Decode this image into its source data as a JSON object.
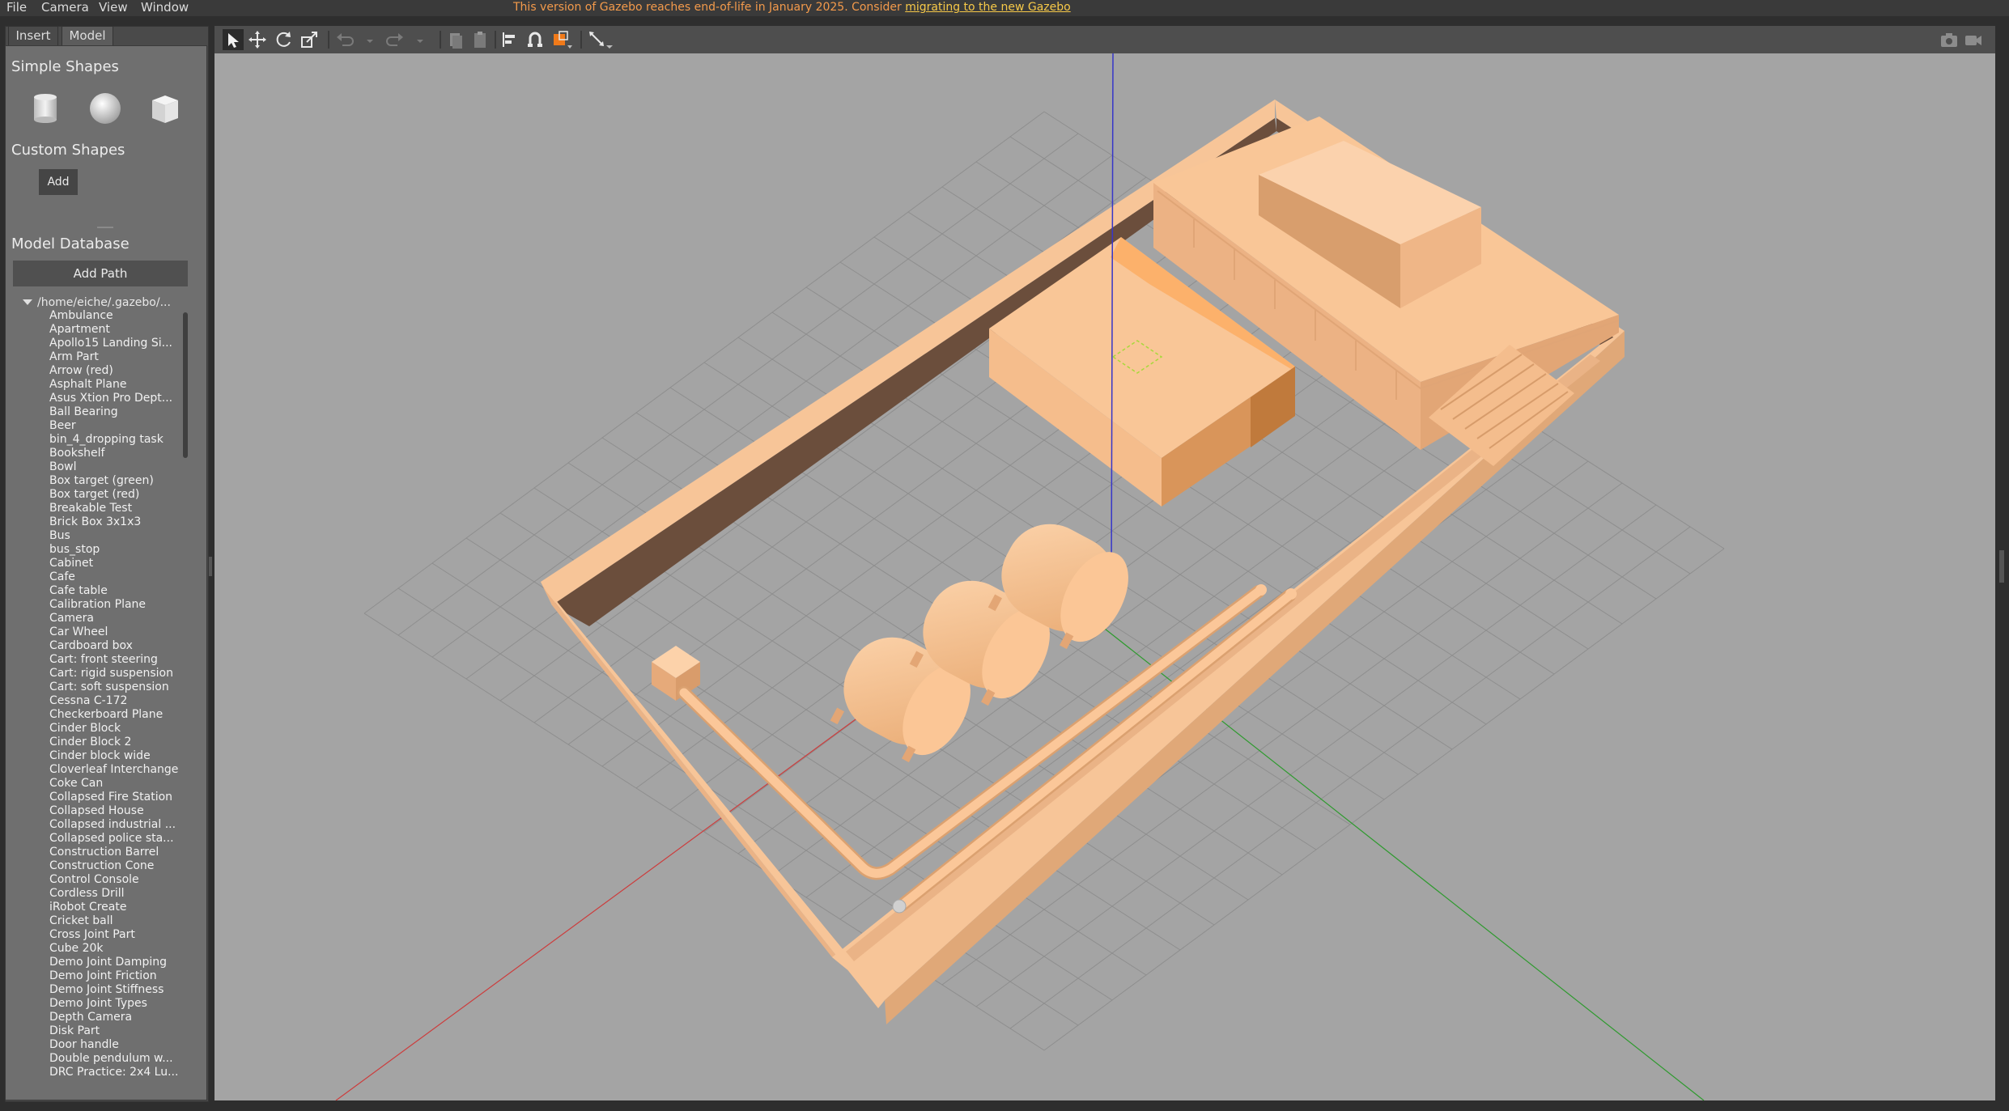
{
  "menubar": {
    "items": [
      "File",
      "Camera",
      "View",
      "Window"
    ]
  },
  "banner": {
    "text": "This version of Gazebo reaches end-of-life in January 2025. Consider",
    "link": "migrating to the new Gazebo"
  },
  "tabs": {
    "insert": "Insert",
    "model": "Model"
  },
  "insert_panel": {
    "simple_shapes": "Simple Shapes",
    "shape_icons": [
      "cylinder-icon",
      "sphere-icon",
      "box-icon"
    ],
    "custom_shapes": "Custom Shapes",
    "add_label": "Add",
    "model_database": "Model Database",
    "add_path_label": "Add Path",
    "tree_root": "/home/eiche/.gazebo/...",
    "models": [
      "Ambulance",
      "Apartment",
      "Apollo15 Landing Si...",
      "Arm Part",
      "Arrow (red)",
      "Asphalt Plane",
      "Asus Xtion Pro Dept...",
      "Ball Bearing",
      "Beer",
      "bin_4_dropping task",
      "Bookshelf",
      "Bowl",
      "Box target (green)",
      "Box target (red)",
      "Breakable Test",
      "Brick Box 3x1x3",
      "Bus",
      "bus_stop",
      "Cabinet",
      "Cafe",
      "Cafe table",
      "Calibration Plane",
      "Camera",
      "Car Wheel",
      "Cardboard box",
      "Cart: front steering",
      "Cart: rigid suspension",
      "Cart: soft suspension",
      "Cessna C-172",
      "Checkerboard Plane",
      "Cinder Block",
      "Cinder Block 2",
      "Cinder block wide",
      "Cloverleaf Interchange",
      "Coke Can",
      "Collapsed Fire Station",
      "Collapsed House",
      "Collapsed industrial ...",
      "Collapsed police sta...",
      "Construction Barrel",
      "Construction Cone",
      "Control Console",
      "Cordless Drill",
      "iRobot Create",
      "Cricket ball",
      "Cross Joint Part",
      "Cube 20k",
      "Demo Joint Damping",
      "Demo Joint Friction",
      "Demo Joint Stiffness",
      "Demo Joint Types",
      "Depth Camera",
      "Disk Part",
      "Door handle",
      "Double pendulum w...",
      "DRC Practice: 2x4 Lu..."
    ]
  },
  "toolbar": {
    "tools": [
      "select-arrow-icon",
      "translate-icon",
      "rotate-icon",
      "scale-icon",
      "undo-icon",
      "redo-icon",
      "copy-icon",
      "paste-icon",
      "align-icon",
      "snap-icon",
      "view-angle-icon",
      "measure-icon",
      "screenshot-icon",
      "record-icon"
    ]
  },
  "colors": {
    "viewport_bg": "#a4a4a4",
    "model": "#f9c697",
    "model_shadow": "#6b4f3d",
    "selected": "#ff9f4a",
    "axis_x": "#d23b3b",
    "axis_y": "#3fa03f",
    "axis_z": "#3b3bd2"
  }
}
